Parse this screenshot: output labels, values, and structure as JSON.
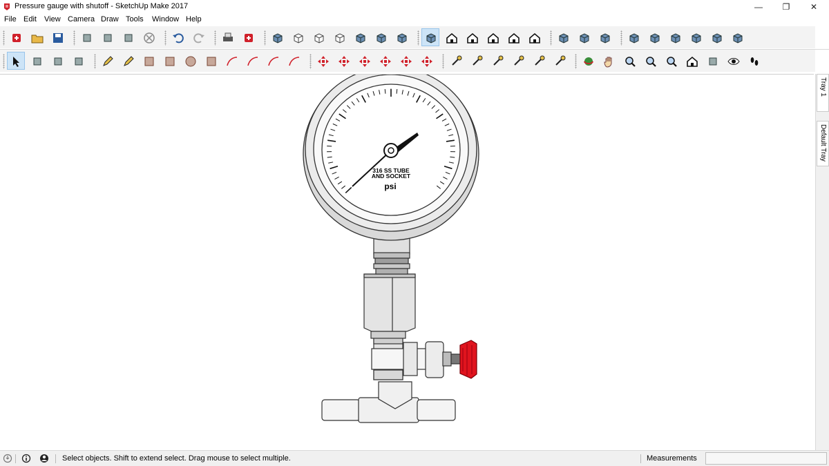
{
  "window": {
    "title": "Pressure gauge with shutoff - SketchUp Make 2017",
    "minimize_glyph": "—",
    "maximize_glyph": "❐",
    "close_glyph": "✕"
  },
  "menu": [
    "File",
    "Edit",
    "View",
    "Camera",
    "Draw",
    "Tools",
    "Window",
    "Help"
  ],
  "toolbar_row1": [
    "get-models-icon",
    "open-icon",
    "save-icon",
    "cut-icon",
    "copy-icon",
    "paste-icon",
    "erase-icon",
    "undo-icon",
    "redo-icon",
    "print-icon",
    "model-info-icon",
    "xray-icon",
    "back-edges-icon",
    "wireframe-icon",
    "hidden-line-icon",
    "shaded-icon",
    "shaded-textures-icon",
    "monochrome-icon",
    "iso-view-icon",
    "top-view-icon",
    "front-view-icon",
    "right-view-icon",
    "back-view-icon",
    "left-view-icon",
    "section-plane-icon",
    "display-section-planes-icon",
    "display-section-cuts-icon",
    "outer-shell-icon",
    "intersect-icon",
    "union-icon",
    "subtract-icon",
    "trim-icon",
    "split-icon"
  ],
  "toolbar_row2": [
    "select-icon",
    "make-component-icon",
    "paint-bucket-icon",
    "eraser-icon",
    "line-icon",
    "freehand-icon",
    "rectangle-icon",
    "rotated-rectangle-icon",
    "circle-icon",
    "polygon-icon",
    "arc-icon",
    "two-point-arc-icon",
    "three-point-arc-icon",
    "pie-icon",
    "move-icon",
    "push-pull-icon",
    "rotate-icon",
    "follow-me-icon",
    "scale-icon",
    "offset-icon",
    "tape-measure-icon",
    "dimension-icon",
    "protractor-icon",
    "text-icon",
    "axes-icon",
    "3d-text-icon",
    "orbit-icon",
    "pan-icon",
    "zoom-icon",
    "zoom-window-icon",
    "zoom-extents-icon",
    "previous-view-icon",
    "position-camera-icon",
    "look-around-icon",
    "walk-icon"
  ],
  "active_tool_row1": "iso-view-icon",
  "active_tool_row2": "select-icon",
  "model": {
    "dial_line1": "316 SS TUBE",
    "dial_line2": "AND SOCKET",
    "dial_unit": "psi",
    "handle_color": "#e0141e"
  },
  "tray": {
    "tab1": "Tray 1",
    "tab2": "Default Tray"
  },
  "status": {
    "message": "Select objects. Shift to extend select. Drag mouse to select multiple.",
    "measurements_label": "Measurements",
    "measurements_value": ""
  },
  "colors": {
    "toolbar_bg": "#f3f3f3",
    "active_tool_bg": "#cde4f7",
    "app_red": "#d0202a"
  }
}
